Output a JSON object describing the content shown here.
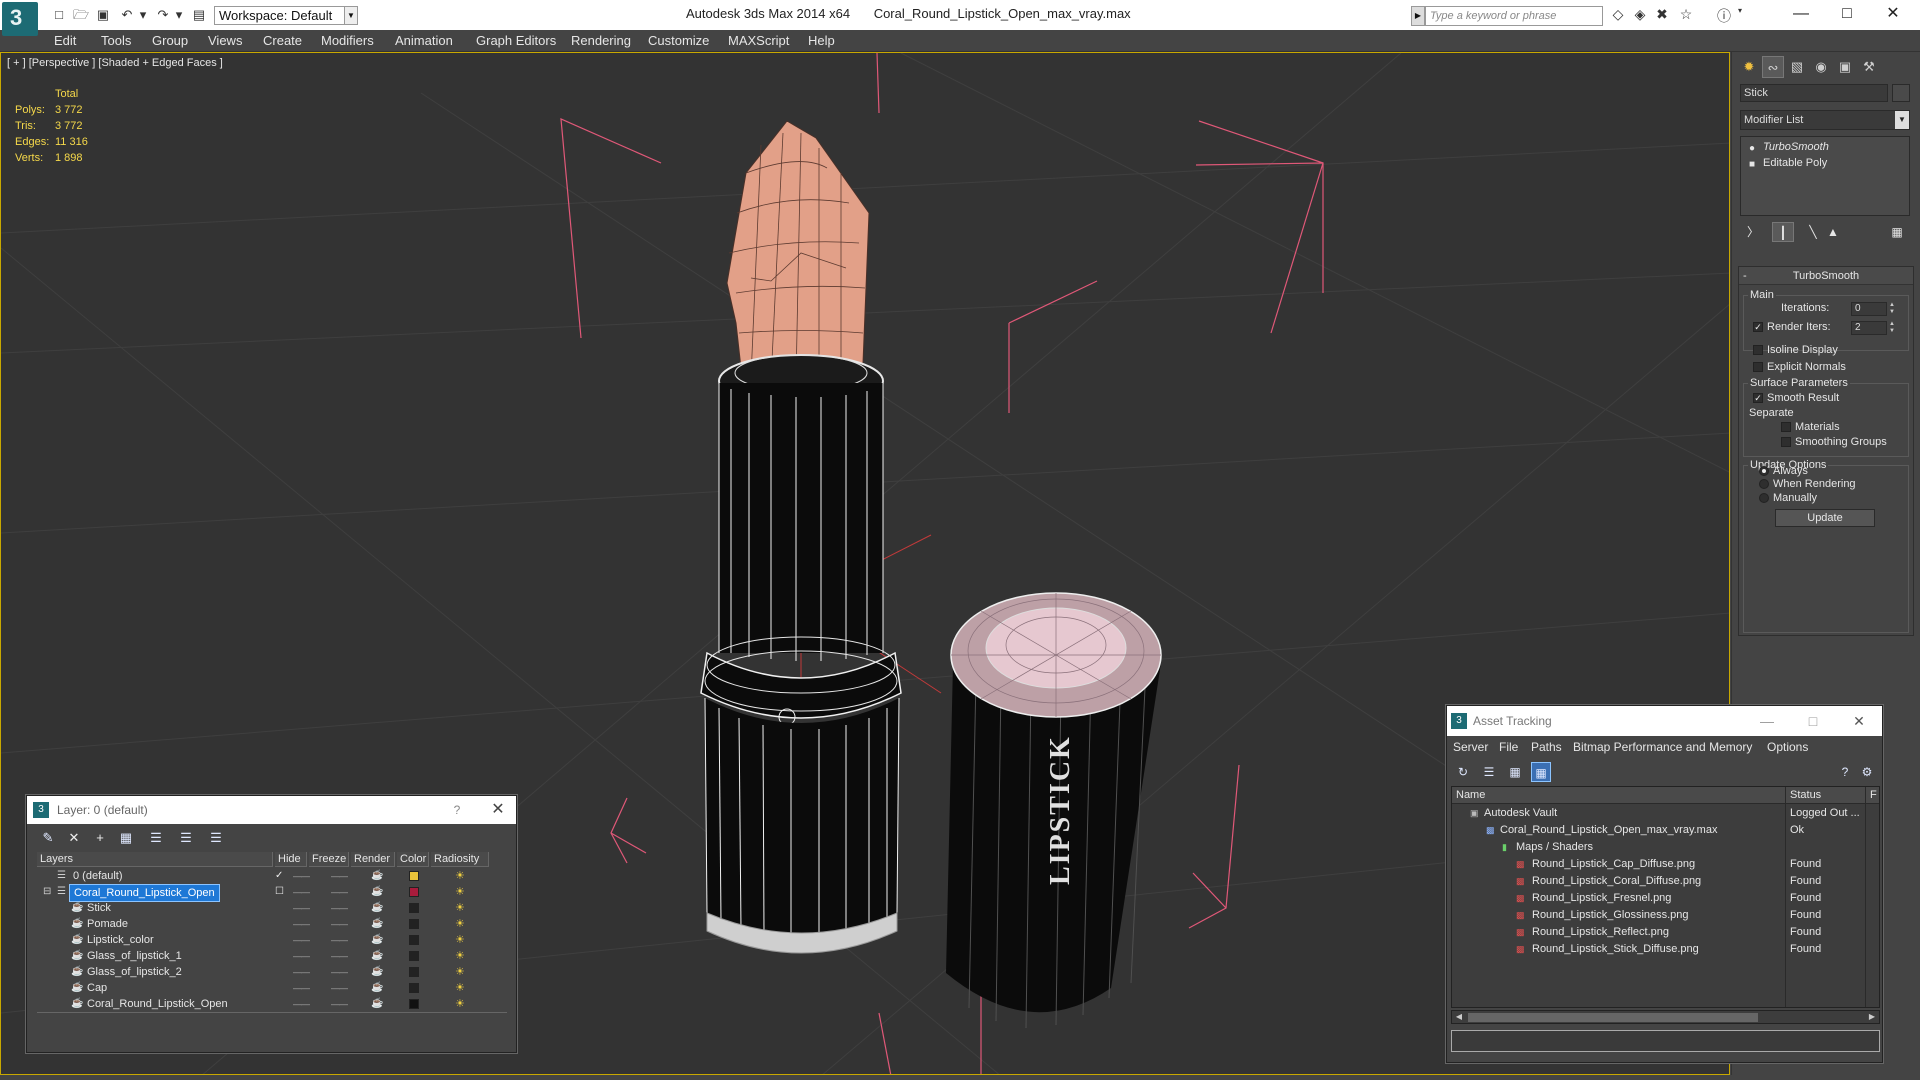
{
  "titlebar": {
    "workspace": "Workspace: Default",
    "app_name": "Autodesk 3ds Max  2014 x64",
    "file_name": "Coral_Round_Lipstick_Open_max_vray.max",
    "search_placeholder": "Type a keyword or phrase"
  },
  "menu": [
    "Edit",
    "Tools",
    "Group",
    "Views",
    "Create",
    "Modifiers",
    "Animation",
    "Graph Editors",
    "Rendering",
    "Customize",
    "MAXScript",
    "Help"
  ],
  "viewport": {
    "label": "[ + ] [Perspective ] [Shaded + Edged Faces ]",
    "stats_header": "Total",
    "stats": [
      {
        "label": "Polys:",
        "value": "3 772"
      },
      {
        "label": "Tris:",
        "value": "3 772"
      },
      {
        "label": "Edges:",
        "value": "11 316"
      },
      {
        "label": "Verts:",
        "value": "1 898"
      }
    ],
    "cap_text": "LIPSTICK"
  },
  "command_panel": {
    "object_name": "Stick",
    "modifier_list": "Modifier List",
    "stack": [
      "TurboSmooth",
      "Editable Poly"
    ],
    "rollout_title": "TurboSmooth",
    "main_label": "Main",
    "iterations_label": "Iterations:",
    "iterations_value": "0",
    "render_iters_label": "Render Iters:",
    "render_iters_value": "2",
    "isoline": "Isoline Display",
    "explicit": "Explicit Normals",
    "surface_label": "Surface Parameters",
    "smooth_result": "Smooth Result",
    "separate": "Separate",
    "materials": "Materials",
    "smoothing_groups": "Smoothing Groups",
    "update_options": "Update Options",
    "always": "Always",
    "when_rendering": "When Rendering",
    "manually": "Manually",
    "update_button": "Update"
  },
  "layer_dialog": {
    "title": "Layer: 0 (default)",
    "help": "?",
    "columns": [
      "Layers",
      "Hide",
      "Freeze",
      "Render",
      "Color",
      "Radiosity"
    ],
    "rows": [
      {
        "name": "0 (default)",
        "color": "#e8c23a"
      },
      {
        "name": "Coral_Round_Lipstick_Open",
        "color": "#a81c3c"
      },
      {
        "name": "Stick",
        "color": "#222222"
      },
      {
        "name": "Pomade",
        "color": "#222222"
      },
      {
        "name": "Lipstick_color",
        "color": "#222222"
      },
      {
        "name": "Glass_of_lipstick_1",
        "color": "#222222"
      },
      {
        "name": "Glass_of_lipstick_2",
        "color": "#222222"
      },
      {
        "name": "Cap",
        "color": "#222222"
      },
      {
        "name": "Coral_Round_Lipstick_Open",
        "color": "#111111"
      }
    ]
  },
  "asset_dialog": {
    "title": "Asset Tracking",
    "menu": [
      "Server",
      "File",
      "Paths",
      "Bitmap Performance and Memory",
      "Options"
    ],
    "columns": [
      "Name",
      "Status",
      "F"
    ],
    "rows": [
      {
        "name": "Autodesk Vault",
        "status": "Logged Out ..."
      },
      {
        "name": "Coral_Round_Lipstick_Open_max_vray.max",
        "status": "Ok"
      },
      {
        "name": "Maps / Shaders",
        "status": ""
      },
      {
        "name": "Round_Lipstick_Cap_Diffuse.png",
        "status": "Found"
      },
      {
        "name": "Round_Lipstick_Coral_Diffuse.png",
        "status": "Found"
      },
      {
        "name": "Round_Lipstick_Fresnel.png",
        "status": "Found"
      },
      {
        "name": "Round_Lipstick_Glossiness.png",
        "status": "Found"
      },
      {
        "name": "Round_Lipstick_Reflect.png",
        "status": "Found"
      },
      {
        "name": "Round_Lipstick_Stick_Diffuse.png",
        "status": "Found"
      }
    ]
  },
  "colors": {
    "viewport_border": "#c8a800",
    "stats_text": "#f5d84a",
    "selection": "#1e78d6",
    "bounding_box": "#e05878",
    "lipstick": "#e2a088"
  }
}
